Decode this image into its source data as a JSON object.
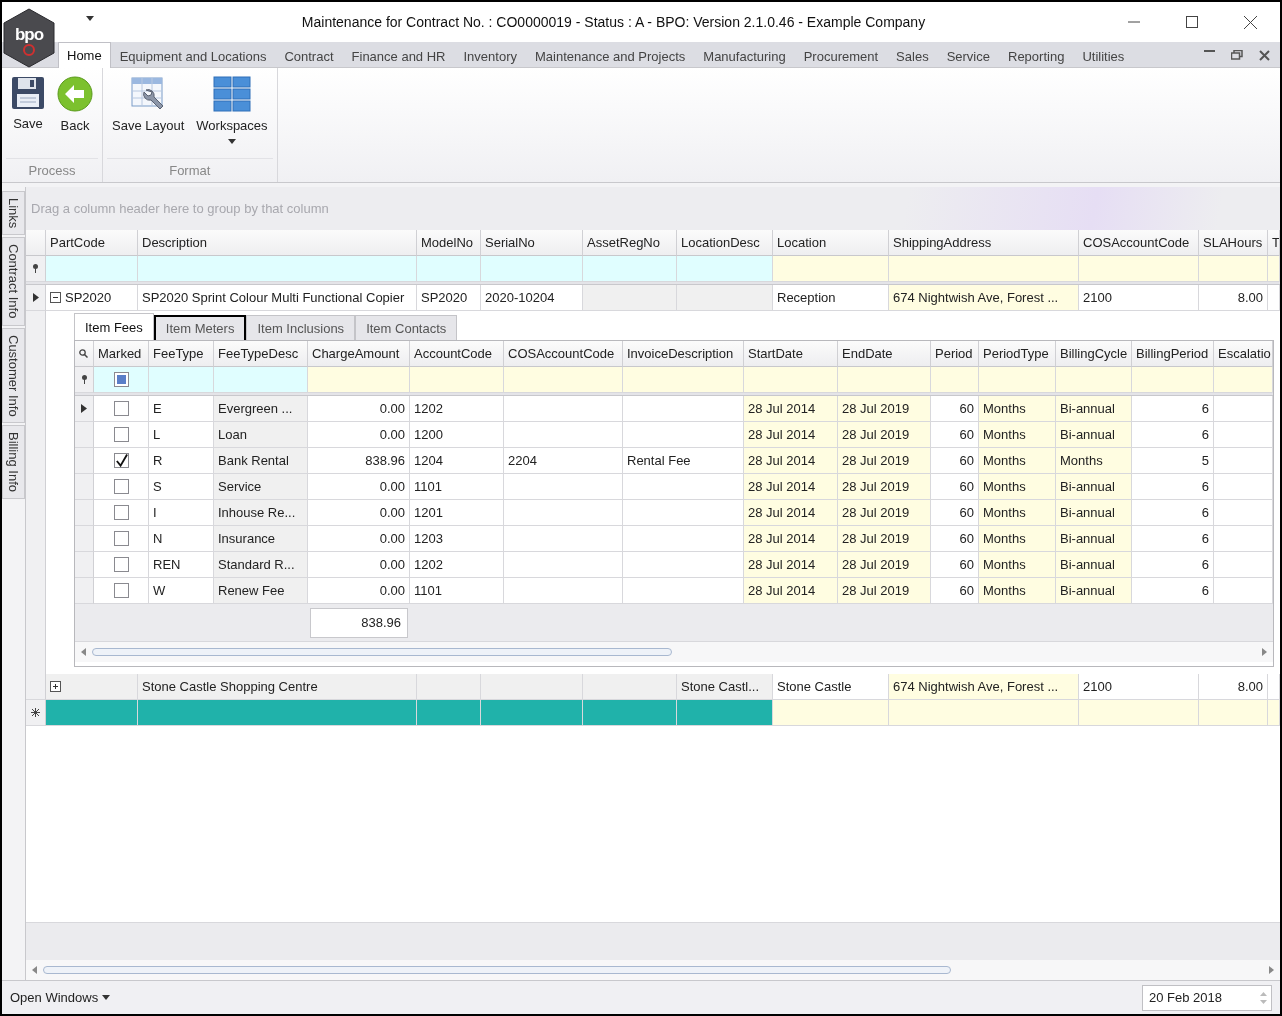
{
  "window": {
    "title": "Maintenance for Contract No. : CO0000019 - Status : A - BPO: Version 2.1.0.46 - Example Company",
    "logo_text": "bpo"
  },
  "ribbon": {
    "tabs": [
      {
        "label": "Home",
        "selected": true
      },
      {
        "label": "Equipment and Locations",
        "selected": false
      },
      {
        "label": "Contract",
        "selected": false
      },
      {
        "label": "Finance and HR",
        "selected": false
      },
      {
        "label": "Inventory",
        "selected": false
      },
      {
        "label": "Maintenance and Projects",
        "selected": false
      },
      {
        "label": "Manufacturing",
        "selected": false
      },
      {
        "label": "Procurement",
        "selected": false
      },
      {
        "label": "Sales",
        "selected": false
      },
      {
        "label": "Service",
        "selected": false
      },
      {
        "label": "Reporting",
        "selected": false
      },
      {
        "label": "Utilities",
        "selected": false
      }
    ],
    "groups": [
      {
        "label": "Process",
        "buttons": [
          {
            "label": "Save",
            "kind": "save"
          },
          {
            "label": "Back",
            "kind": "back"
          }
        ]
      },
      {
        "label": "Format",
        "buttons": [
          {
            "label": "Save Layout",
            "kind": "layout"
          },
          {
            "label": "Workspaces",
            "kind": "workspaces",
            "dropdown": true
          }
        ]
      }
    ]
  },
  "side_tabs": [
    "Links",
    "Contract Info",
    "Customer Info",
    "Billing Info"
  ],
  "grid": {
    "group_panel": "Drag a column header here to group by that column",
    "columns": [
      {
        "label": "PartCode",
        "kind": "key"
      },
      {
        "label": "Description",
        "kind": "key"
      },
      {
        "label": "ModelNo",
        "kind": "key"
      },
      {
        "label": "SerialNo",
        "kind": "key"
      },
      {
        "label": "AssetRegNo",
        "kind": "key_readonly"
      },
      {
        "label": "LocationDesc",
        "kind": "key_readonly"
      },
      {
        "label": "Location",
        "kind": "plain"
      },
      {
        "label": "ShippingAddress",
        "kind": "lookup"
      },
      {
        "label": "COSAccountCode",
        "kind": "plain"
      },
      {
        "label": "SLAHours",
        "kind": "number"
      },
      {
        "label": "T",
        "kind": "plain"
      }
    ],
    "rows": [
      {
        "current": true,
        "expanded": true,
        "shaded": false,
        "cells": [
          "SP2020",
          "SP2020 Sprint Colour Multi Functional Copier",
          "SP2020",
          "2020-10204",
          "",
          "",
          "Reception",
          "674 Nightwish Ave, Forest ...",
          "2100",
          "8.00",
          ""
        ]
      },
      {
        "current": false,
        "expanded": false,
        "shaded": true,
        "cells": [
          "",
          "Stone Castle Shopping Centre",
          "",
          "",
          "",
          "Stone Castl...",
          "Stone Castle",
          "674 Nightwish Ave, Forest ...",
          "2100",
          "8.00",
          ""
        ]
      }
    ],
    "new_row": {
      "color": "#20b2aa"
    }
  },
  "detail": {
    "tabs": [
      {
        "label": "Item Fees",
        "selected": true,
        "focused": false
      },
      {
        "label": "Item Meters",
        "selected": false,
        "focused": true
      },
      {
        "label": "Item Inclusions",
        "selected": false,
        "focused": false
      },
      {
        "label": "Item Contacts",
        "selected": false,
        "focused": false
      }
    ],
    "marked_header": "Marked",
    "marked_filter_indeterminate": true,
    "columns": [
      {
        "label": "FeeType",
        "kind": "key"
      },
      {
        "label": "FeeTypeDesc",
        "kind": "key_readonly"
      },
      {
        "label": "ChargeAmount",
        "kind": "number"
      },
      {
        "label": "AccountCode",
        "kind": "plain"
      },
      {
        "label": "COSAccountCode",
        "kind": "plain"
      },
      {
        "label": "InvoiceDescription",
        "kind": "plain"
      },
      {
        "label": "StartDate",
        "kind": "lookup"
      },
      {
        "label": "EndDate",
        "kind": "lookup"
      },
      {
        "label": "Period",
        "kind": "number"
      },
      {
        "label": "PeriodType",
        "kind": "lookup"
      },
      {
        "label": "BillingCycle",
        "kind": "lookup"
      },
      {
        "label": "BillingPeriod",
        "kind": "number"
      },
      {
        "label": "Escalatio",
        "kind": "plain"
      }
    ],
    "rows": [
      {
        "current": true,
        "marked": false,
        "cells": [
          "E",
          "Evergreen ...",
          "0.00",
          "1202",
          "",
          "",
          "28 Jul 2014",
          "28 Jul 2019",
          "60",
          "Months",
          "Bi-annual",
          "6",
          ""
        ]
      },
      {
        "current": false,
        "marked": false,
        "cells": [
          "L",
          "Loan",
          "0.00",
          "1200",
          "",
          "",
          "28 Jul 2014",
          "28 Jul 2019",
          "60",
          "Months",
          "Bi-annual",
          "6",
          ""
        ]
      },
      {
        "current": false,
        "marked": true,
        "cells": [
          "R",
          "Bank Rental",
          "838.96",
          "1204",
          "2204",
          "Rental Fee",
          "28 Jul 2014",
          "28 Jul 2019",
          "60",
          "Months",
          "Months",
          "5",
          ""
        ]
      },
      {
        "current": false,
        "marked": false,
        "cells": [
          "S",
          "Service",
          "0.00",
          "1101",
          "",
          "",
          "28 Jul 2014",
          "28 Jul 2019",
          "60",
          "Months",
          "Bi-annual",
          "6",
          ""
        ]
      },
      {
        "current": false,
        "marked": false,
        "cells": [
          "I",
          "Inhouse Re...",
          "0.00",
          "1201",
          "",
          "",
          "28 Jul 2014",
          "28 Jul 2019",
          "60",
          "Months",
          "Bi-annual",
          "6",
          ""
        ]
      },
      {
        "current": false,
        "marked": false,
        "cells": [
          "N",
          "Insurance",
          "0.00",
          "1203",
          "",
          "",
          "28 Jul 2014",
          "28 Jul 2019",
          "60",
          "Months",
          "Bi-annual",
          "6",
          ""
        ]
      },
      {
        "current": false,
        "marked": false,
        "cells": [
          "REN",
          "Standard R...",
          "0.00",
          "1202",
          "",
          "",
          "28 Jul 2014",
          "28 Jul 2019",
          "60",
          "Months",
          "Bi-annual",
          "6",
          ""
        ]
      },
      {
        "current": false,
        "marked": false,
        "cells": [
          "W",
          "Renew Fee",
          "0.00",
          "1101",
          "",
          "",
          "28 Jul 2014",
          "28 Jul 2019",
          "60",
          "Months",
          "Bi-annual",
          "6",
          ""
        ]
      }
    ],
    "total": "838.96"
  },
  "status_bar": {
    "open_windows": "Open Windows",
    "date": "20 Feb 2018"
  }
}
